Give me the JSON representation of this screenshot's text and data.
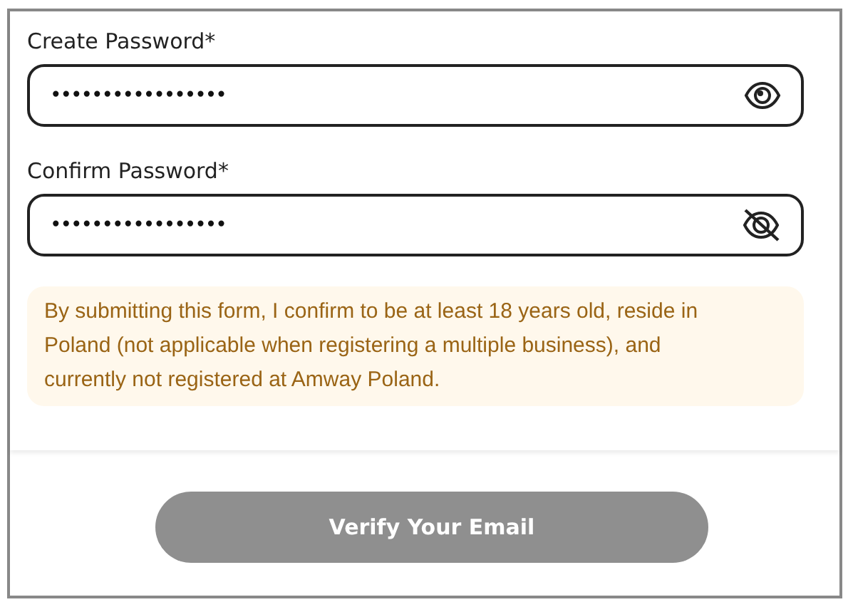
{
  "fields": [
    {
      "label": "Create Password*",
      "value": "•••••••••••••••••",
      "kind": "eye"
    },
    {
      "label": "Confirm Password*",
      "value": "•••••••••••••••••",
      "kind": "eye-slash"
    }
  ],
  "notice": "By submitting this form, I confirm to be at least 18 years old, reside in Poland (not applicable when registering a multiple business), and currently not registered at Amway Poland.",
  "submit": {
    "label": "Verify Your Email",
    "disabled": true
  }
}
